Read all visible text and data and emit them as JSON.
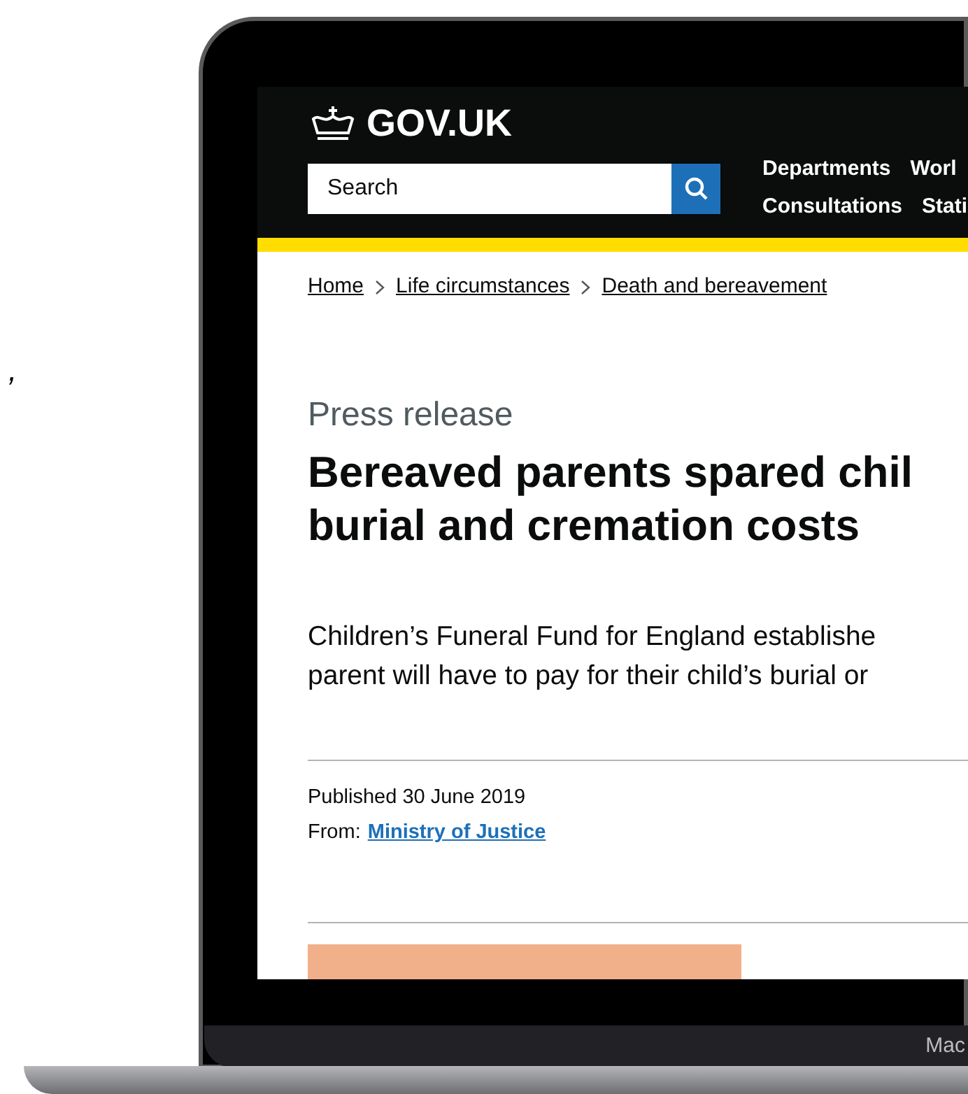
{
  "stray_text": ",",
  "header": {
    "logo": "GOV.UK",
    "search": {
      "placeholder": "Search"
    },
    "nav": [
      [
        "Departments",
        "Worl"
      ],
      [
        "Consultations",
        "Stati"
      ]
    ]
  },
  "breadcrumbs": [
    "Home",
    "Life circumstances",
    "Death and bereavement"
  ],
  "article": {
    "kind_label": "Press release",
    "title_lines": [
      "Bereaved parents spared chil",
      "burial and cremation costs"
    ],
    "lead_lines": [
      "Children’s Funeral Fund for England establishe",
      "parent will have to pay for their child’s burial or"
    ],
    "published": "Published 30 June 2019",
    "from_label": "From:",
    "from_link": "Ministry of Justice"
  },
  "laptop": {
    "badge": "Mac"
  }
}
